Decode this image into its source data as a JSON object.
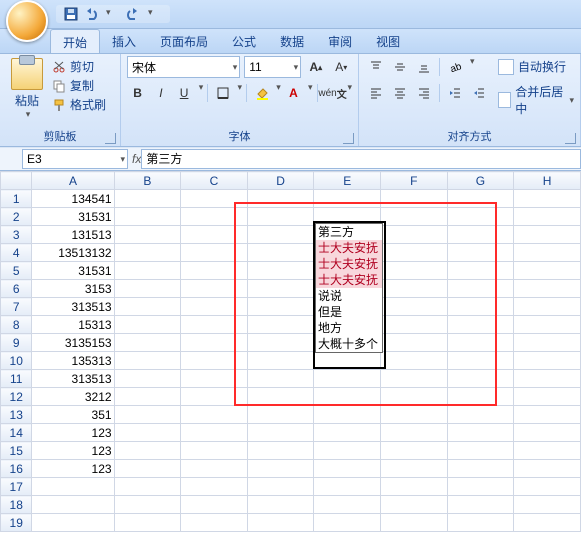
{
  "qat": {
    "save": "保存",
    "undo": "撤销",
    "redo": "重做"
  },
  "tabs": [
    "开始",
    "插入",
    "页面布局",
    "公式",
    "数据",
    "审阅",
    "视图"
  ],
  "active_tab": 0,
  "ribbon": {
    "clipboard": {
      "paste": "粘贴",
      "cut": "剪切",
      "copy": "复制",
      "format_painter": "格式刷",
      "label": "剪贴板"
    },
    "font": {
      "name": "宋体",
      "size": "11",
      "label": "字体"
    },
    "align": {
      "wrap": "自动换行",
      "merge": "合并后居中",
      "label": "对齐方式"
    }
  },
  "namebox": "E3",
  "formula": "第三方",
  "columns": [
    "A",
    "B",
    "C",
    "D",
    "E",
    "F",
    "G",
    "H"
  ],
  "rows": [
    1,
    2,
    3,
    4,
    5,
    6,
    7,
    8,
    9,
    10,
    11,
    12,
    13,
    14,
    15,
    16,
    17,
    18,
    19
  ],
  "colA_data": {
    "1": "134541",
    "2": "31531",
    "3": "131513",
    "4": "13513132",
    "5": "31531",
    "6": "3153",
    "7": "313513",
    "8": "15313",
    "9": "3135153",
    "10": "135313",
    "11": "313513",
    "12": "3212",
    "13": "351",
    "14": "123",
    "15": "123",
    "16": "123"
  },
  "floating_list": [
    {
      "t": "第三方",
      "hl": false
    },
    {
      "t": "士大夫安抚",
      "hl": true
    },
    {
      "t": "士大夫安抚",
      "hl": true
    },
    {
      "t": "士大夫安抚",
      "hl": true
    },
    {
      "t": "说说",
      "hl": false
    },
    {
      "t": "但是",
      "hl": false
    },
    {
      "t": "地方",
      "hl": false
    },
    {
      "t": "大概十多个",
      "hl": false
    }
  ],
  "chart_data": null
}
